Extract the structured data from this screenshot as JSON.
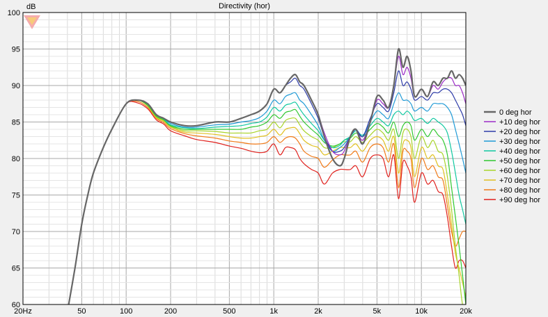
{
  "window": {
    "title": "Directivity (hor)",
    "y_unit": "dB",
    "logo": "red-heart-logo"
  },
  "chart_data": {
    "type": "line",
    "title": "Directivity (hor)",
    "ylabel": "dB",
    "xlabel": "",
    "x_scale": "log",
    "xlim": [
      20,
      20000
    ],
    "ylim": [
      60,
      100
    ],
    "grid": true,
    "legend_position": "right",
    "x_tick_labels": [
      "20Hz",
      "50",
      "100",
      "200",
      "500",
      "1k",
      "2k",
      "5k",
      "10k",
      "20k"
    ],
    "x_tick_values": [
      20,
      50,
      100,
      200,
      500,
      1000,
      2000,
      5000,
      10000,
      20000
    ],
    "y_tick_labels": [
      "60",
      "65",
      "70",
      "75",
      "80",
      "85",
      "90",
      "95",
      "100"
    ],
    "y_tick_values": [
      60,
      65,
      70,
      75,
      80,
      85,
      90,
      95,
      100
    ],
    "x": [
      40,
      45,
      50,
      55,
      60,
      70,
      80,
      100,
      120,
      140,
      160,
      180,
      200,
      250,
      300,
      400,
      500,
      600,
      700,
      800,
      900,
      1000,
      1100,
      1200,
      1300,
      1400,
      1500,
      1600,
      1800,
      2000,
      2200,
      2500,
      2800,
      3000,
      3300,
      3600,
      4000,
      4500,
      5000,
      5500,
      6000,
      6500,
      7000,
      7500,
      8000,
      8500,
      9000,
      10000,
      11000,
      12000,
      13000,
      14000,
      15000,
      16000,
      17000,
      18000,
      19000,
      20000
    ],
    "series": [
      {
        "name": "0 deg hor",
        "color": "#666666",
        "width": 2.2,
        "values": [
          59,
          65,
          71,
          75,
          78,
          81.5,
          84,
          87.5,
          88,
          87.5,
          86,
          85.5,
          85,
          84.5,
          84.5,
          85,
          85,
          85.5,
          86,
          86.5,
          87.5,
          89.5,
          89,
          90,
          91,
          91.5,
          90.5,
          90,
          88,
          86,
          83,
          80,
          79,
          80,
          83,
          84,
          82,
          85,
          88.5,
          88,
          87,
          90,
          95,
          92.5,
          94,
          92,
          88.5,
          89.5,
          88.5,
          90.5,
          90,
          91,
          91,
          92,
          91,
          91.5,
          91,
          90
        ]
      },
      {
        "name": "+10 deg hor",
        "color": "#9c2bc7",
        "width": 1.2,
        "values": [
          59,
          65,
          71,
          75,
          78,
          81.5,
          84,
          87.5,
          88,
          87.5,
          86,
          85.5,
          85,
          84.5,
          84.5,
          85,
          85,
          85.5,
          86,
          86.5,
          87.5,
          89.5,
          89,
          90,
          91,
          91.5,
          90.5,
          90,
          88,
          86,
          83.5,
          81,
          80.5,
          81,
          83,
          84,
          82.5,
          85,
          88,
          87.5,
          87,
          90,
          94,
          91.5,
          92.5,
          91,
          88.5,
          89.5,
          88.5,
          90,
          89.5,
          90.5,
          91,
          91,
          90,
          90,
          89,
          87.5
        ]
      },
      {
        "name": "+20 deg hor",
        "color": "#2d3ba8",
        "width": 1.2,
        "values": [
          59,
          65,
          71,
          75,
          78,
          81.5,
          84,
          87.5,
          88,
          87.5,
          86,
          85.5,
          85,
          84.5,
          84.5,
          85,
          85,
          85.5,
          86,
          86.5,
          87.5,
          89.5,
          89,
          90,
          90.5,
          91,
          90,
          89.5,
          87.5,
          85.5,
          83,
          81,
          81,
          81.5,
          83,
          84,
          83,
          85.5,
          87.5,
          87,
          86.5,
          89,
          92,
          90,
          90.5,
          89.5,
          88,
          88.5,
          88,
          89,
          89,
          89.5,
          89.5,
          89,
          88,
          87,
          86,
          84.5
        ]
      },
      {
        "name": "+30 deg hor",
        "color": "#1f9ad6",
        "width": 1.2,
        "values": [
          59,
          65,
          71,
          75,
          78,
          81.5,
          84,
          87.5,
          88,
          87.5,
          86,
          85.5,
          84.8,
          84.3,
          84.3,
          84.6,
          84.7,
          85,
          85.2,
          85.6,
          86.5,
          88,
          87.5,
          88.5,
          88.8,
          89,
          88,
          87.5,
          86,
          84.5,
          82.5,
          81,
          81.5,
          82,
          83,
          84,
          83,
          85,
          86.5,
          86,
          85.5,
          87.5,
          89,
          88,
          88,
          87.5,
          86.5,
          87,
          86.5,
          87.5,
          87.5,
          87.5,
          87,
          86,
          84,
          82,
          80,
          78
        ]
      },
      {
        "name": "+40 deg hor",
        "color": "#10c8a0",
        "width": 1.2,
        "values": [
          59,
          65,
          71,
          75,
          78,
          81.5,
          84,
          87.5,
          88,
          87.5,
          86,
          85.4,
          84.6,
          84.2,
          84.1,
          84.3,
          84.4,
          84.5,
          84.8,
          85,
          85.7,
          87,
          86.5,
          87.3,
          87.5,
          87.7,
          86.8,
          86,
          84.8,
          83.8,
          82.5,
          81.5,
          81.8,
          82.5,
          83,
          83.8,
          83.2,
          84.5,
          85.5,
          85,
          84.5,
          86,
          86.5,
          86,
          86.5,
          86,
          85.2,
          85.5,
          84.8,
          85.5,
          85,
          84.5,
          83.5,
          81,
          78,
          75,
          73,
          71
        ]
      },
      {
        "name": "+50 deg hor",
        "color": "#30c830",
        "width": 1.2,
        "values": [
          59,
          65,
          71,
          75,
          78,
          81.5,
          84,
          87.5,
          88,
          87.3,
          85.8,
          85.3,
          84.5,
          84,
          84,
          84,
          84,
          84,
          84.3,
          84.5,
          85,
          86,
          85.5,
          86.3,
          86.5,
          86.7,
          85.8,
          85,
          84,
          83.2,
          82.2,
          81.7,
          82,
          82.5,
          82.8,
          83.5,
          83,
          84,
          84.8,
          84.3,
          83.5,
          85,
          83,
          84.5,
          85,
          84.5,
          82.5,
          84,
          83,
          84,
          83.2,
          82.5,
          80.5,
          76,
          72,
          68,
          64,
          60
        ]
      },
      {
        "name": "+60 deg hor",
        "color": "#a8d42a",
        "width": 1.2,
        "values": [
          59,
          65,
          71,
          75,
          78,
          81.5,
          84,
          87.5,
          88,
          87.2,
          85.7,
          85.2,
          84.4,
          83.8,
          83.8,
          83.7,
          83.5,
          83.5,
          83.5,
          83.8,
          84,
          85,
          84.2,
          85.2,
          85.5,
          85.5,
          84.6,
          83.8,
          83,
          82.5,
          81.5,
          81.5,
          82,
          82.3,
          82.3,
          83,
          82.2,
          83.2,
          84,
          83.5,
          82.5,
          84,
          80,
          83.5,
          84,
          83,
          80,
          83,
          81.5,
          82.5,
          81,
          80.5,
          77.5,
          73,
          68,
          64,
          60,
          60
        ]
      },
      {
        "name": "+70 deg hor",
        "color": "#e0c020",
        "width": 1.2,
        "values": [
          59,
          65,
          71,
          75,
          78,
          81.5,
          84,
          87.5,
          88,
          87.2,
          85.6,
          85.1,
          84.3,
          83.6,
          83.5,
          83.3,
          83,
          82.8,
          82.8,
          83,
          83.2,
          84,
          83.2,
          84,
          84.2,
          84.2,
          83.4,
          82.5,
          81.8,
          81.5,
          80.5,
          81,
          81.5,
          81.5,
          81.5,
          82,
          81,
          82.5,
          83,
          82.5,
          81,
          83,
          78,
          82,
          82.5,
          81.5,
          77.5,
          81.5,
          80,
          80.5,
          79,
          78.5,
          75,
          71,
          67,
          65,
          63,
          61
        ]
      },
      {
        "name": "+80 deg hor",
        "color": "#f07a18",
        "width": 1.2,
        "values": [
          59,
          65,
          71,
          75,
          78,
          81.5,
          84,
          87.5,
          87.8,
          87,
          85.5,
          84.9,
          84.1,
          83.4,
          83.1,
          82.8,
          82.4,
          82.2,
          82,
          82,
          82.2,
          83,
          82.2,
          82.8,
          83,
          82.8,
          82,
          81,
          80.3,
          80,
          78.8,
          79.8,
          80.5,
          80.5,
          80.5,
          81,
          79.5,
          81.5,
          82,
          81.5,
          79.5,
          82,
          76,
          81,
          81,
          80,
          76,
          80,
          78.5,
          79,
          77.5,
          77,
          73.5,
          70,
          68,
          69,
          70,
          70
        ]
      },
      {
        "name": "+90 deg hor",
        "color": "#e0201c",
        "width": 1.2,
        "values": [
          59,
          65,
          71,
          75,
          78,
          81.5,
          84,
          87.5,
          87.6,
          86.8,
          85.3,
          84.7,
          83.8,
          83.1,
          82.6,
          82.2,
          81.7,
          81.4,
          81,
          80.8,
          81,
          82,
          80.5,
          81.5,
          81.5,
          81.2,
          80,
          79.3,
          78.5,
          78,
          76.5,
          78,
          78.5,
          78.5,
          78.5,
          79,
          77.5,
          80,
          80.5,
          80,
          77.5,
          80.5,
          74.5,
          79.5,
          79,
          77.5,
          74,
          78,
          76.5,
          77,
          75.5,
          75,
          72,
          68,
          65,
          66,
          66,
          65
        ]
      }
    ]
  }
}
